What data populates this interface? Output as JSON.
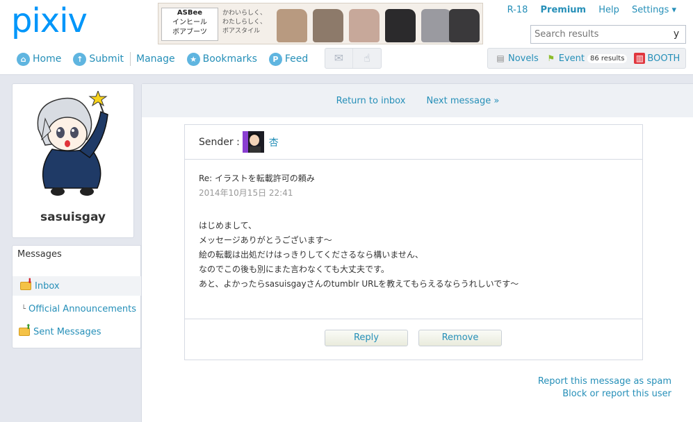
{
  "header": {
    "logo": "pixiv",
    "banner": {
      "brand_line1": "ASBee",
      "brand_line2": "インヒール",
      "brand_line3": "ボアブーツ",
      "tagline_line1": "かわいらしく、",
      "tagline_line2": "わたしらしく、",
      "tagline_line3": "ボアスタイル"
    },
    "top_links": [
      "R-18",
      "Premium",
      "Help",
      "Settings ▾"
    ],
    "search": {
      "placeholder": "Search results",
      "button": "y"
    },
    "nav": [
      "Home",
      "Submit",
      "Manage",
      "Bookmarks",
      "Feed"
    ],
    "right_nav": {
      "novels": "Novels",
      "event": "Event",
      "event_badge": "86 results",
      "booth": "BOOTH"
    }
  },
  "sidebar": {
    "username": "sasuisgay",
    "messages_title": "Messages",
    "items": [
      {
        "label": "Inbox",
        "prefix": ""
      },
      {
        "label": "Official Announcements",
        "prefix": "└"
      },
      {
        "label": "Sent Messages",
        "prefix": ""
      }
    ]
  },
  "main": {
    "return_link": "Return to inbox",
    "next_link": "Next message »",
    "sender_label": "Sender :",
    "sender_name": "杏",
    "subject": "Re: イラストを転載許可の頼み",
    "date": "2014年10月15日 22:41",
    "body_lines": [
      "はじめまして、",
      "メッセージありがとうございます〜",
      "絵の転載は出処だけはっきりしてくださるなら構いません、",
      "なのでこの後も別にまた言わなくても大丈夫です。",
      "あと、よかったらsasuisgayさんのtumblr URLを教えてもらえるならうれしいです〜"
    ],
    "reply_button": "Reply",
    "remove_button": "Remove",
    "report_spam": "Report this message as spam",
    "block_report": "Block or report this user"
  },
  "colors": {
    "accent": "#258fb8",
    "logo": "#0096fa",
    "page_bg": "#e4e7ee"
  }
}
